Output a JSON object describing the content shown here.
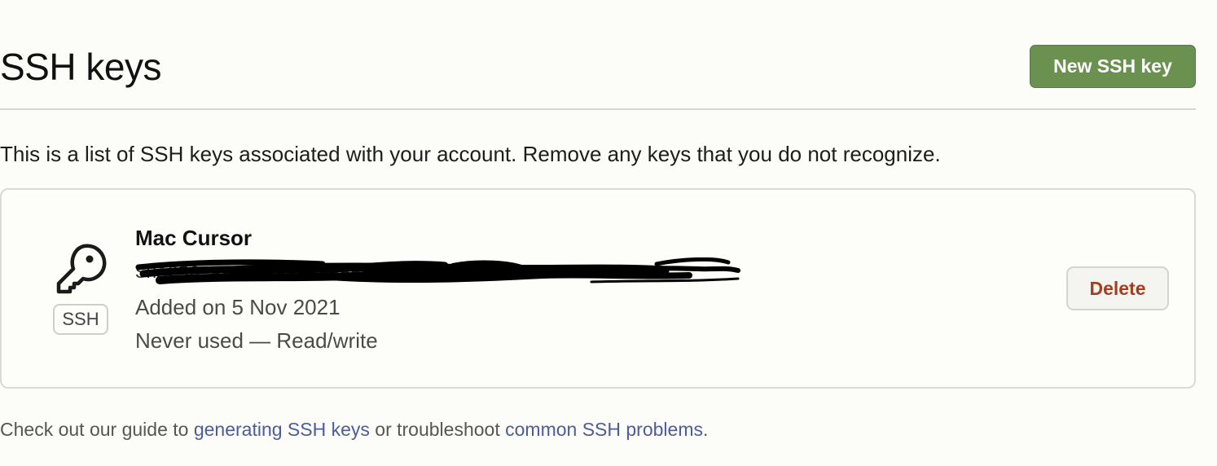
{
  "header": {
    "title": "SSH keys",
    "new_key_button_label": "New SSH key"
  },
  "description": "This is a list of SSH keys associated with your account. Remove any keys that you do not recognize.",
  "keys": [
    {
      "name": "Mac Cursor",
      "type_badge": "SSH",
      "fingerprint_redacted": "SHA256:●●●●●●●●●●●●●●●●●●●●●●●●●●●●●●●●●●●●M10",
      "added": "Added on 5 Nov 2021",
      "usage": "Never used — Read/write",
      "delete_label": "Delete",
      "icon": "key-icon"
    }
  ],
  "footer": {
    "prefix": "Check out our guide to ",
    "link1": "generating SSH keys",
    "middle": " or troubleshoot ",
    "link2": "common SSH problems",
    "suffix": "."
  },
  "colors": {
    "primary_button": "#6a9150",
    "danger_text": "#a33f20",
    "link": "#4d5c9a",
    "background": "#fcfcf8"
  }
}
